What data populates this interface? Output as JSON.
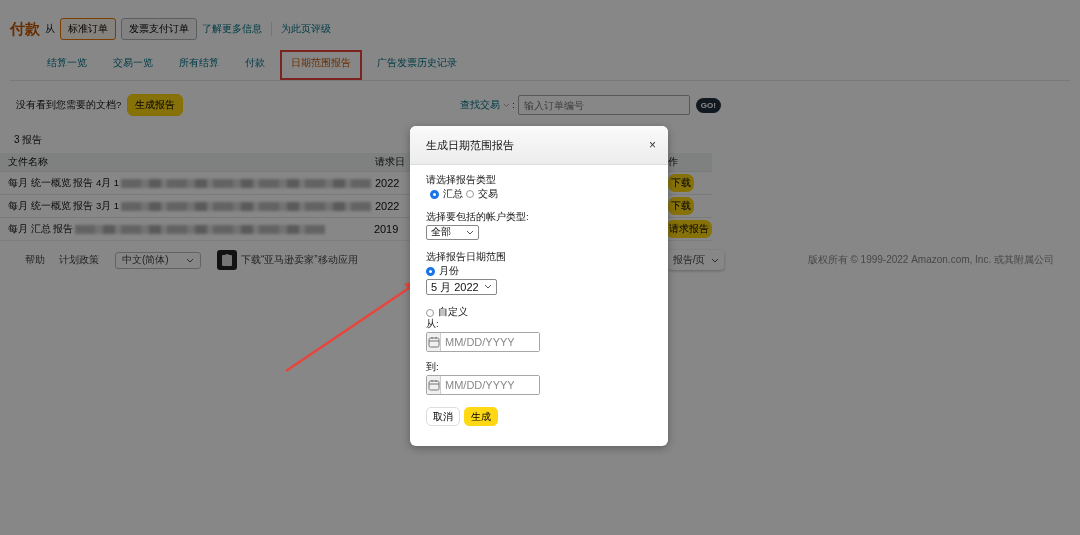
{
  "header": {
    "title": "付款",
    "from": "从",
    "buttons": [
      "标准订单",
      "发票支付订单"
    ],
    "links": [
      "了解更多信息",
      "为此页评级"
    ]
  },
  "tabs": [
    {
      "label": "结算一览",
      "selected": false,
      "highlighted": false
    },
    {
      "label": "交易一览",
      "selected": false,
      "highlighted": false
    },
    {
      "label": "所有结算",
      "selected": false,
      "highlighted": false
    },
    {
      "label": "付款",
      "selected": false,
      "highlighted": false
    },
    {
      "label": "日期范围报告",
      "selected": true,
      "highlighted": true
    },
    {
      "label": "广告发票历史记录",
      "selected": false,
      "highlighted": false
    }
  ],
  "prompt": {
    "text": "没有看到您需要的文档?",
    "button": "生成报告"
  },
  "search": {
    "label": "查找交易",
    "separator": ":",
    "placeholder": "输入订单编号",
    "button": "GO!"
  },
  "report_count": "3 报告",
  "table": {
    "columns": [
      "文件名称",
      "请求日",
      "作"
    ],
    "rows": [
      {
        "name": "每月 统一概览 报告 4月 1",
        "redacted": true,
        "date": "2022",
        "action": "下载"
      },
      {
        "name": "每月 统一概览 报告 3月 1",
        "redacted": true,
        "date": "2022",
        "action": "下载"
      },
      {
        "name": "每月 汇总 报告",
        "redacted": true,
        "date": "2019",
        "action": "请求报告"
      }
    ]
  },
  "page_size": "报告/页",
  "footer": {
    "links": [
      "帮助",
      "计划政策"
    ],
    "language": "中文(简体)",
    "app": "下载“亚马逊卖家”移动应用",
    "copyright": "版权所有 © 1999-2022 Amazon.com, Inc. 或其附属公司"
  },
  "dialog": {
    "title": "生成日期范围报告",
    "close": "×",
    "report_type": {
      "label": "请选择报告类型",
      "options": [
        {
          "label": "汇总",
          "selected": true
        },
        {
          "label": "交易",
          "selected": false
        }
      ]
    },
    "account_type": {
      "label": "选择要包括的帐户类型:",
      "value": "全部"
    },
    "date_range": {
      "label": "选择报告日期范围",
      "options": [
        {
          "kind": "month",
          "label": "月份",
          "selected": true,
          "value": "5 月 2022"
        },
        {
          "kind": "custom",
          "label": "自定义",
          "selected": false,
          "fields": [
            {
              "label": "从:",
              "placeholder": "MM/DD/YYYY"
            },
            {
              "label": "到:",
              "placeholder": "MM/DD/YYYY"
            }
          ]
        }
      ]
    },
    "buttons": [
      {
        "kind": "cancel",
        "label": "取消"
      },
      {
        "kind": "primary",
        "label": "生成"
      }
    ]
  }
}
